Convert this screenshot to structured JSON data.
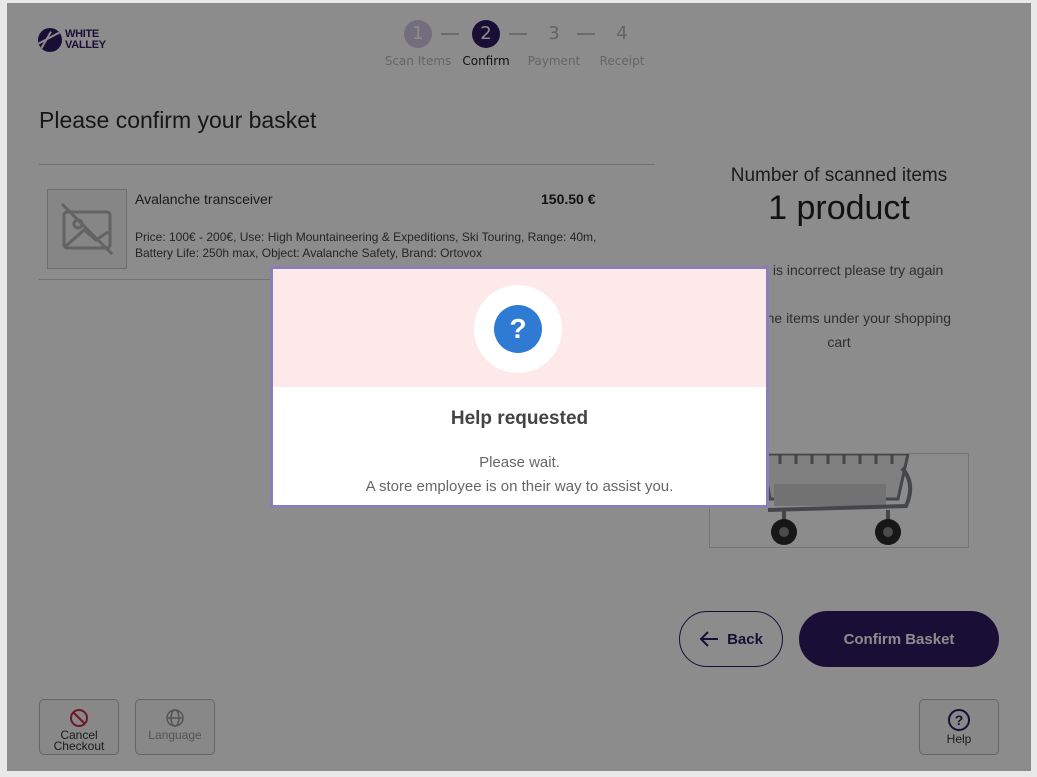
{
  "brand": {
    "line1": "WHITE",
    "line2": "VALLEY",
    "color": "#2e1a63"
  },
  "stepper": {
    "steps": [
      {
        "number": "1",
        "label": "Scan Items",
        "state": "done"
      },
      {
        "number": "2",
        "label": "Confirm",
        "state": "active"
      },
      {
        "number": "3",
        "label": "Payment",
        "state": "upcoming"
      },
      {
        "number": "4",
        "label": "Receipt",
        "state": "upcoming"
      }
    ]
  },
  "basket": {
    "title": "Please confirm your basket",
    "items": [
      {
        "name": "Avalanche transceiver",
        "price": "150.50 €",
        "description": "Price: 100€ - 200€, Use: High Mountaineering & Expeditions, Ski Touring, Range: 40m, Battery Life: 250h max, Object: Avalanche Safety, Brand: Ortovox",
        "image_icon": "image-placeholder-icon"
      }
    ]
  },
  "summary": {
    "heading": "Number of scanned items",
    "count": "1 product",
    "hint1": "count is incorrect please try again",
    "hint2": "mber the items under your shopping cart"
  },
  "buttons": {
    "back": "Back",
    "confirm": "Confirm Basket"
  },
  "footer": {
    "cancel": "Cancel Checkout",
    "language": "Language",
    "help": "Help"
  },
  "modal": {
    "icon": "question-icon",
    "title": "Help requested",
    "line1": "Please wait.",
    "line2": "A store employee is on their way to assist you."
  },
  "colors": {
    "accent": "#2e1a63",
    "modal_header": "#fde8ea",
    "help_icon": "#2f7ad3",
    "cancel_icon": "#c62b4f"
  }
}
